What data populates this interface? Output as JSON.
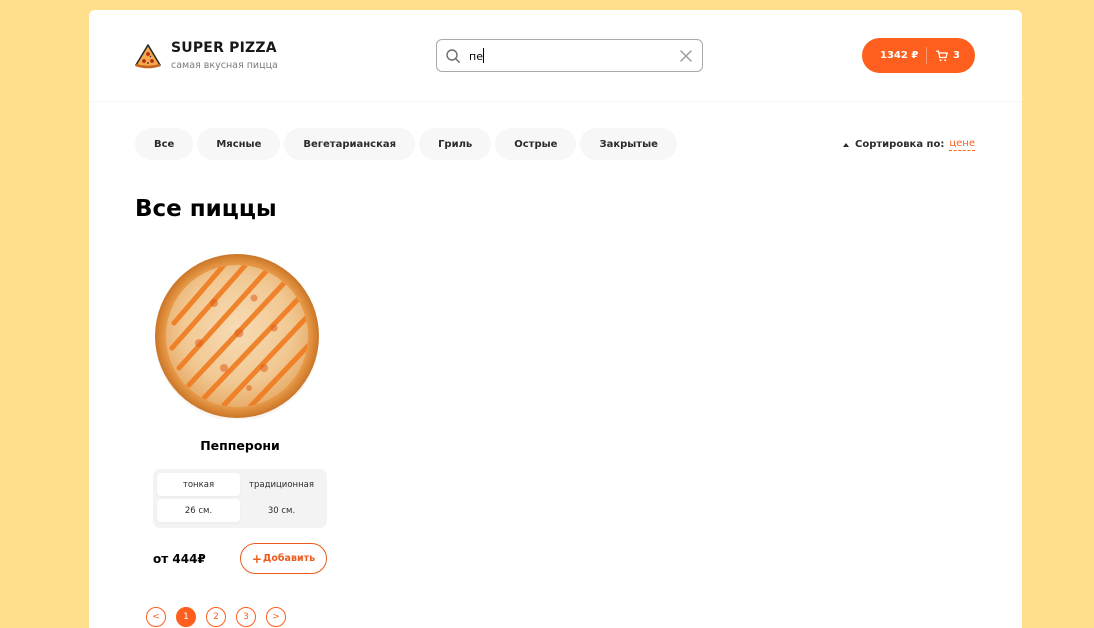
{
  "logo": {
    "icon": "pizza-slice-icon",
    "title": "SUPER PIZZA",
    "subtitle": "самая вкусная пицца"
  },
  "search": {
    "value": "пе",
    "placeholder": "",
    "icon": "search-icon",
    "clear_icon": "close-icon"
  },
  "cart": {
    "price": "1342 ₽",
    "count": "3",
    "icon": "cart-icon"
  },
  "categories": [
    "Все",
    "Мясные",
    "Вегетарианская",
    "Гриль",
    "Острые",
    "Закрытые"
  ],
  "sort": {
    "label": "Сортировка по:",
    "value": "цене"
  },
  "content": {
    "title": "Все пиццы"
  },
  "pizzas": [
    {
      "title": "Пепперони",
      "types": [
        "тонкая",
        "традиционная"
      ],
      "active_type": "тонкая",
      "sizes": [
        "26 см.",
        "30 см."
      ],
      "active_size": "26 см.",
      "price": "от 444₽",
      "add_label": "Добавить",
      "add_icon": "plus-icon"
    }
  ],
  "pagination": {
    "prev": "<",
    "pages": [
      "1",
      "2",
      "3"
    ],
    "active": "1",
    "next": ">"
  },
  "colors": {
    "accent": "#fe5f1e",
    "background": "#ffdf8c"
  }
}
